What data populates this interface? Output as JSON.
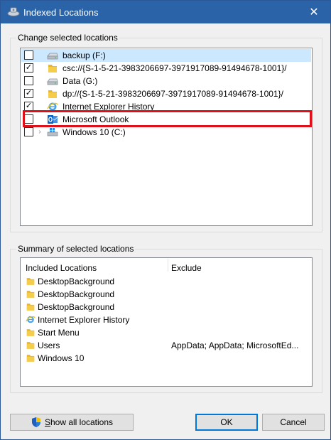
{
  "window": {
    "title": "Indexed Locations",
    "title_icon": "search-index-icon",
    "close_glyph": "✕"
  },
  "change_group": {
    "legend": "Change selected locations",
    "items": [
      {
        "label": "backup (F:)",
        "icon": "drive-icon",
        "checked": false,
        "selected": true,
        "expander": false
      },
      {
        "label": "csc://{S-1-5-21-3983206697-3971917089-91494678-1001}/",
        "icon": "folder-icon",
        "checked": true,
        "selected": false,
        "expander": false
      },
      {
        "label": "Data (G:)",
        "icon": "drive-icon",
        "checked": false,
        "selected": false,
        "expander": false
      },
      {
        "label": "dp://{S-1-5-21-3983206697-3971917089-91494678-1001}/",
        "icon": "folder-icon",
        "checked": true,
        "selected": false,
        "expander": false
      },
      {
        "label": "Internet Explorer History",
        "icon": "internet-explorer-icon",
        "checked": true,
        "selected": false,
        "expander": false
      },
      {
        "label": "Microsoft Outlook",
        "icon": "outlook-icon",
        "checked": false,
        "selected": false,
        "expander": false,
        "highlighted": true
      },
      {
        "label": "Windows 10 (C:)",
        "icon": "windows-drive-icon",
        "checked": false,
        "selected": false,
        "expander": true
      }
    ]
  },
  "summary_group": {
    "legend": "Summary of selected locations",
    "col_included": "Included Locations",
    "col_exclude": "Exclude",
    "rows": [
      {
        "label": "DesktopBackground",
        "icon": "folder-icon",
        "exclude": ""
      },
      {
        "label": "DesktopBackground",
        "icon": "folder-icon",
        "exclude": ""
      },
      {
        "label": "DesktopBackground",
        "icon": "folder-icon",
        "exclude": ""
      },
      {
        "label": "Internet Explorer History",
        "icon": "internet-explorer-icon",
        "exclude": ""
      },
      {
        "label": "Start Menu",
        "icon": "folder-icon",
        "exclude": ""
      },
      {
        "label": "Users",
        "icon": "folder-icon",
        "exclude": "AppData; AppData; MicrosoftEd..."
      },
      {
        "label": "Windows 10",
        "icon": "folder-icon",
        "exclude": ""
      }
    ]
  },
  "buttons": {
    "show_all_first": "S",
    "show_all_rest": "how all locations",
    "ok": "OK",
    "cancel": "Cancel"
  },
  "colors": {
    "titlebar": "#2b63a8",
    "selection": "#cce8ff",
    "highlight": "#e0101a",
    "folder": "#e8b730",
    "default_button_border": "#0078d7"
  }
}
